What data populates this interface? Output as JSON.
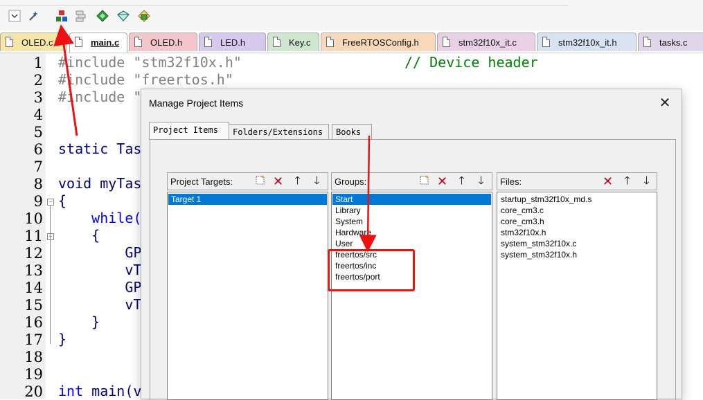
{
  "toolbar": {
    "buttons": [
      {
        "name": "dropdown-icon"
      },
      {
        "name": "magic-wand-icon"
      },
      {
        "name": "manage-project-items-icon"
      },
      {
        "name": "stack-icon"
      },
      {
        "name": "green-diamond-icon"
      },
      {
        "name": "diamond-outline-icon"
      },
      {
        "name": "multi-project-icon"
      }
    ]
  },
  "tabs": [
    {
      "label": "OLED.c",
      "color": "#f5e6a8"
    },
    {
      "label": "main.c",
      "color": "#ffffff",
      "active": true
    },
    {
      "label": "OLED.h",
      "color": "#f4c6cc"
    },
    {
      "label": "LED.h",
      "color": "#d7c8ee"
    },
    {
      "label": "Key.c",
      "color": "#cfe6cf"
    },
    {
      "label": "FreeRTOSConfig.h",
      "color": "#f8d8b8"
    },
    {
      "label": "stm32f10x_it.c",
      "color": "#ead0e4"
    },
    {
      "label": "stm32f10x_it.h",
      "color": "#d8e2f2"
    },
    {
      "label": "tasks.c",
      "color": "#e0d6ea"
    }
  ],
  "editor": {
    "line_numbers": [
      "1",
      "2",
      "3",
      "4",
      "5",
      "6",
      "7",
      "8",
      "9",
      "10",
      "11",
      "12",
      "13",
      "14",
      "15",
      "16",
      "17",
      "18",
      "19",
      "20"
    ],
    "code": {
      "l1_inc": "#include ",
      "l1_str": "\"stm32f10x.h\"",
      "l1_cmt": "// Device header",
      "l2_inc": "#include ",
      "l2_str": "\"freertos.h\"",
      "l3_inc": "#include ",
      "l3_str": "\"",
      "l6": "static Tas",
      "l8": "void myTas",
      "l9": "{",
      "l10": "    while(",
      "l11": "    {",
      "l12": "        GP",
      "l13": "        vT",
      "l14": "        GP",
      "l15": "        vT",
      "l16": "    }",
      "l17": "}",
      "l20_kw": "int",
      "l20_rest": " main(v"
    }
  },
  "dialog": {
    "title": "Manage Project Items",
    "close": "✕",
    "tabs": [
      "Project Items",
      "Folders/Extensions",
      "Books"
    ],
    "targets": {
      "label": "Project Targets:",
      "items": [
        "Target 1"
      ],
      "selected": 0
    },
    "groups": {
      "label": "Groups:",
      "items": [
        "Start",
        "Library",
        "System",
        "Hardware",
        "User",
        "freertos/src",
        "freertos/inc",
        "freertos/port"
      ],
      "selected": 0
    },
    "files": {
      "label": "Files:",
      "items": [
        "startup_stm32f10x_md.s",
        "core_cm3.c",
        "core_cm3.h",
        "stm32f10x.h",
        "system_stm32f10x.c",
        "system_stm32f10x.h"
      ]
    },
    "icons": {
      "new": "new-item-icon",
      "delete": "delete-icon",
      "up": "move-up-icon",
      "down": "move-down-icon"
    }
  },
  "annotations": {
    "color": "#ee1111"
  }
}
